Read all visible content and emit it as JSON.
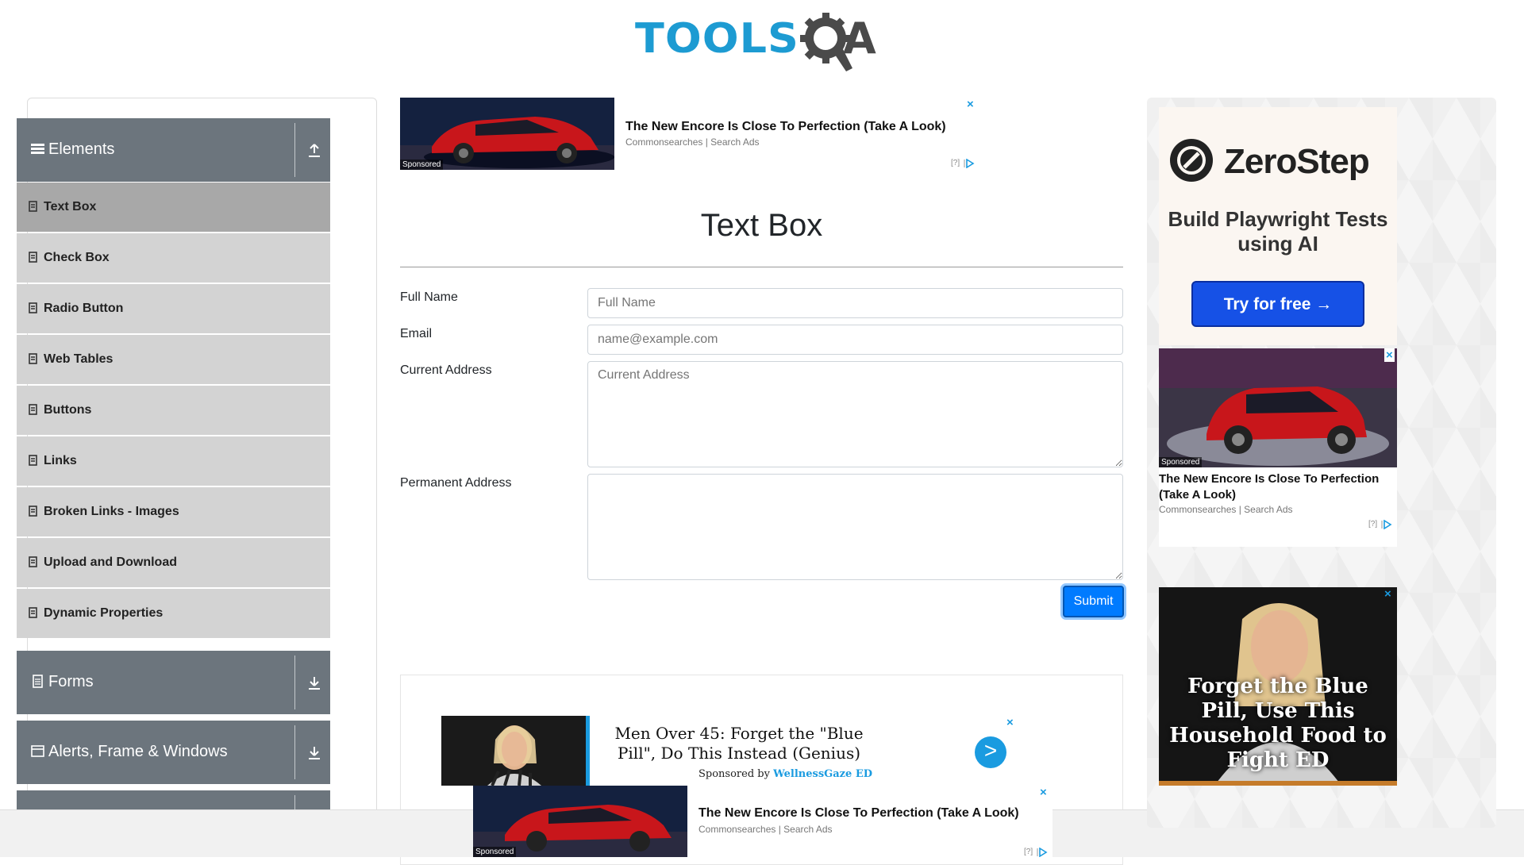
{
  "header": {
    "logo_part1": "TOOLS",
    "logo_part2": "A"
  },
  "sidebar": {
    "groups": [
      {
        "label": "Elements",
        "icon": "menu-icon",
        "toggle": "collapse-up-icon"
      },
      {
        "label": "Forms",
        "icon": "document-icon",
        "toggle": "expand-down-icon"
      },
      {
        "label": "Alerts, Frame & Windows",
        "icon": "window-icon",
        "toggle": "expand-down-icon"
      }
    ],
    "items": [
      {
        "label": "Text Box",
        "active": true
      },
      {
        "label": "Check Box"
      },
      {
        "label": "Radio Button"
      },
      {
        "label": "Web Tables"
      },
      {
        "label": "Buttons"
      },
      {
        "label": "Links"
      },
      {
        "label": "Broken Links - Images"
      },
      {
        "label": "Upload and Download"
      },
      {
        "label": "Dynamic Properties"
      }
    ]
  },
  "main": {
    "title": "Text Box",
    "form": {
      "full_name_label": "Full Name",
      "full_name_placeholder": "Full Name",
      "email_label": "Email",
      "email_placeholder": "name@example.com",
      "current_address_label": "Current Address",
      "current_address_placeholder": "Current Address",
      "permanent_address_label": "Permanent Address",
      "submit_label": "Submit"
    }
  },
  "ads": {
    "top": {
      "title": "The New Encore Is Close To Perfection (Take A Look)",
      "source": "Commonsearches | Search Ads",
      "sponsored": "Sponsored",
      "choice": "[?]",
      "close": "×"
    },
    "men": {
      "headline": "Men Over 45: Forget the \"Blue Pill\", Do This Instead (Genius)",
      "by_prefix": "Sponsored by",
      "by_brand": "WellnessGaze ED",
      "go": ">",
      "close": "×"
    },
    "sticky": {
      "title": "The New Encore Is Close To Perfection (Take A Look)",
      "source": "Commonsearches | Search Ads",
      "sponsored": "Sponsored",
      "choice": "[?]",
      "close": "×"
    },
    "zerostep": {
      "brand": "ZeroStep",
      "subtitle": "Build Playwright Tests using AI",
      "cta": "Try for free →"
    },
    "right_car": {
      "title": "The New Encore Is Close To Perfection (Take A Look)",
      "source": "Commonsearches | Search Ads",
      "sponsored": "Sponsored",
      "choice": "[?]",
      "close": "×"
    },
    "right_ed": {
      "headline": "Forget the Blue Pill, Use This Household Food to Fight ED",
      "close": "×"
    }
  },
  "colors": {
    "accent": "#007bff",
    "sidebar_header": "#6c757d",
    "sidebar_item": "#d3d3d3",
    "sidebar_item_active": "#a8a8a8",
    "logo_blue": "#1d9bd2"
  }
}
